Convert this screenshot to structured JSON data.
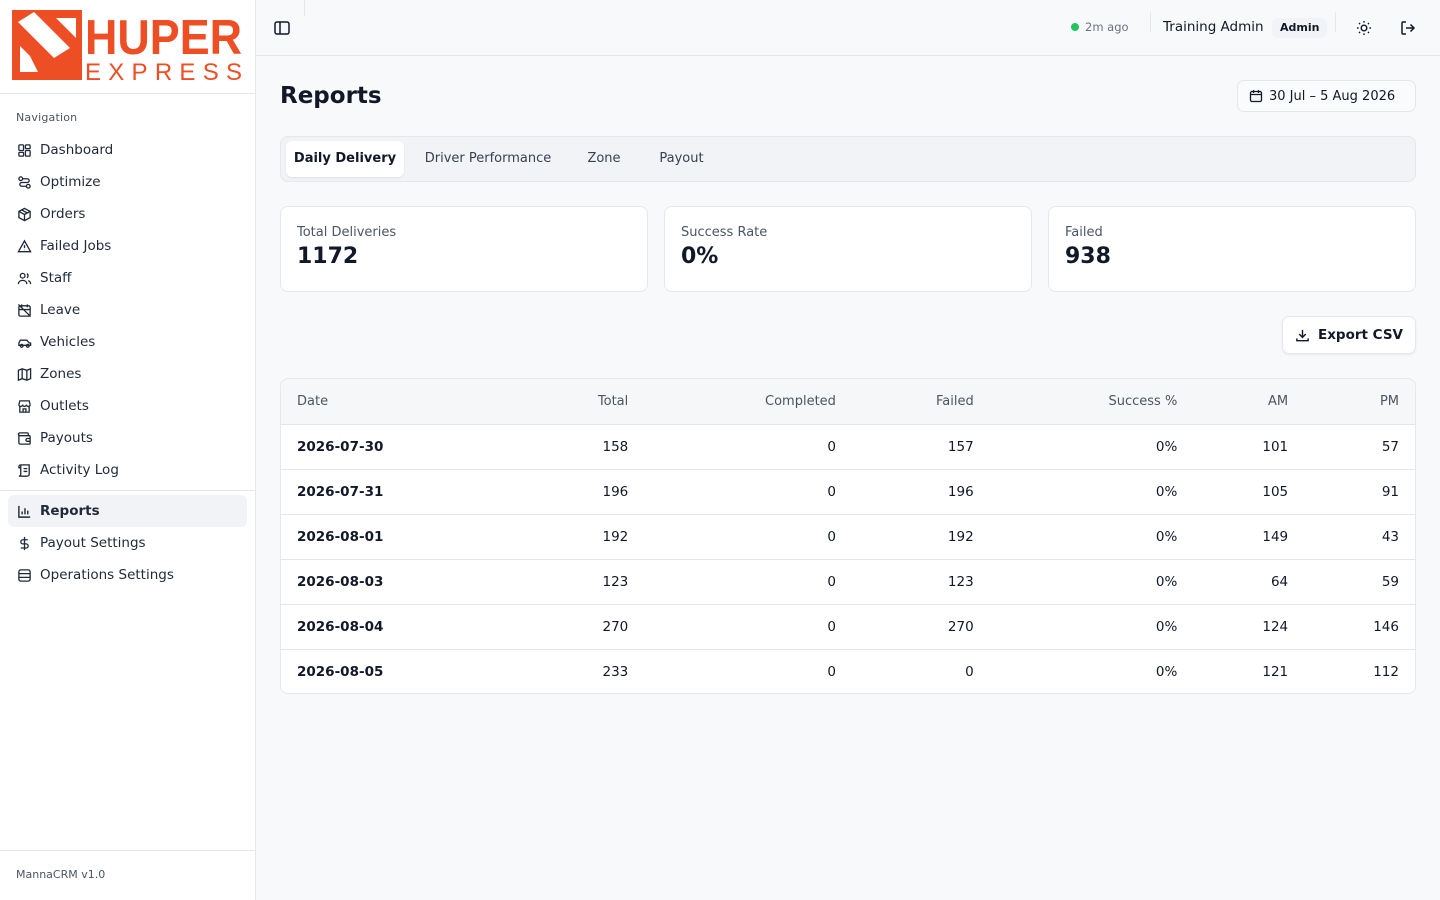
{
  "brand": {
    "logo_top": "HUPER",
    "logo_bottom": "EXPRESS",
    "primary_color": "#ee4e23"
  },
  "sidebar": {
    "section_label": "Navigation",
    "items": [
      {
        "label": "Dashboard",
        "icon": "dashboard-grid-icon"
      },
      {
        "label": "Optimize",
        "icon": "route-icon"
      },
      {
        "label": "Orders",
        "icon": "package-icon"
      },
      {
        "label": "Failed Jobs",
        "icon": "warning-triangle-icon"
      },
      {
        "label": "Staff",
        "icon": "users-icon"
      },
      {
        "label": "Leave",
        "icon": "calendar-off-icon"
      },
      {
        "label": "Vehicles",
        "icon": "car-icon"
      },
      {
        "label": "Zones",
        "icon": "map-icon"
      },
      {
        "label": "Outlets",
        "icon": "store-icon"
      },
      {
        "label": "Payouts",
        "icon": "wallet-icon"
      },
      {
        "label": "Activity Log",
        "icon": "scroll-icon"
      }
    ],
    "secondary_items": [
      {
        "label": "Reports",
        "icon": "bar-chart-icon",
        "active": true
      },
      {
        "label": "Payout Settings",
        "icon": "dollar-icon"
      },
      {
        "label": "Operations Settings",
        "icon": "database-icon"
      }
    ],
    "footer": "MannaCRM v1.0"
  },
  "header": {
    "status_text": "2m ago",
    "status_color": "#22c55e",
    "user_name": "Training Admin",
    "role": "Admin"
  },
  "page": {
    "title": "Reports",
    "date_range": "30 Jul – 5 Aug 2026",
    "tabs": [
      "Daily Delivery",
      "Driver Performance",
      "Zone",
      "Payout"
    ],
    "active_tab": "Daily Delivery",
    "stats": [
      {
        "label": "Total Deliveries",
        "value": "1172"
      },
      {
        "label": "Success Rate",
        "value": "0%"
      },
      {
        "label": "Failed",
        "value": "938"
      }
    ],
    "export_label": "Export CSV"
  },
  "table": {
    "columns": [
      "Date",
      "Total",
      "Completed",
      "Failed",
      "Success %",
      "AM",
      "PM"
    ],
    "rows": [
      [
        "2026-07-30",
        "158",
        "0",
        "157",
        "0%",
        "101",
        "57"
      ],
      [
        "2026-07-31",
        "196",
        "0",
        "196",
        "0%",
        "105",
        "91"
      ],
      [
        "2026-08-01",
        "192",
        "0",
        "192",
        "0%",
        "149",
        "43"
      ],
      [
        "2026-08-03",
        "123",
        "0",
        "123",
        "0%",
        "64",
        "59"
      ],
      [
        "2026-08-04",
        "270",
        "0",
        "270",
        "0%",
        "124",
        "146"
      ],
      [
        "2026-08-05",
        "233",
        "0",
        "0",
        "0%",
        "121",
        "112"
      ]
    ]
  }
}
